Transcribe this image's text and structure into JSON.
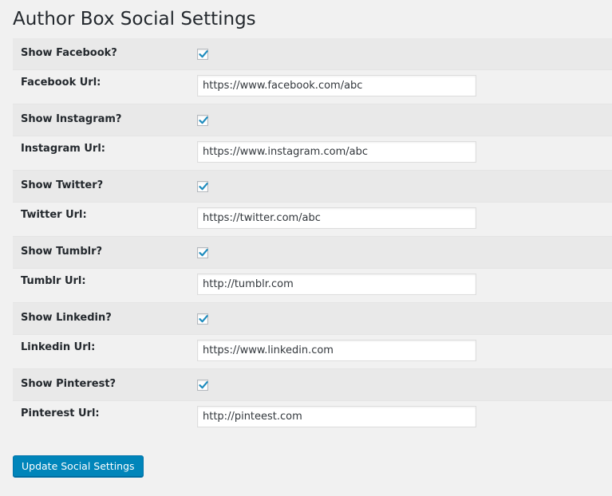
{
  "page": {
    "title": "Author Box Social Settings"
  },
  "settings": [
    {
      "toggle_label": "Show Facebook?",
      "checked": true,
      "url_label": "Facebook Url:",
      "url_value": "https://www.facebook.com/abc"
    },
    {
      "toggle_label": "Show Instagram?",
      "checked": true,
      "url_label": "Instagram Url:",
      "url_value": "https://www.instagram.com/abc"
    },
    {
      "toggle_label": "Show Twitter?",
      "checked": true,
      "url_label": "Twitter Url:",
      "url_value": "https://twitter.com/abc"
    },
    {
      "toggle_label": "Show Tumblr?",
      "checked": true,
      "url_label": "Tumblr Url:",
      "url_value": "http://tumblr.com"
    },
    {
      "toggle_label": "Show Linkedin?",
      "checked": true,
      "url_label": "Linkedin Url:",
      "url_value": "https://www.linkedin.com"
    },
    {
      "toggle_label": "Show Pinterest?",
      "checked": true,
      "url_label": "Pinterest Url:",
      "url_value": "http://pinteest.com"
    }
  ],
  "submit": {
    "label": "Update Social Settings"
  },
  "colors": {
    "background": "#f1f1f1",
    "toggle_row_background": "#e9e9e9",
    "button_blue": "#0085ba",
    "checkmark_blue": "#1e8cbe"
  },
  "icons": {
    "checkbox": "checkmark-icon"
  }
}
